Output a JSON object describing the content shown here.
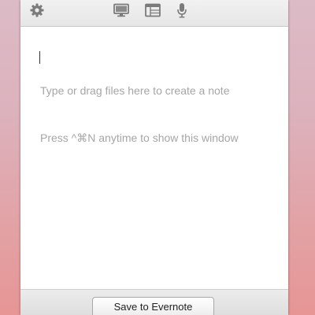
{
  "toolbar": {
    "icons": [
      {
        "name": "gear-icon",
        "color": "#7a7a7a"
      },
      {
        "name": "display-icon",
        "color": "#7a7a7a"
      },
      {
        "name": "window-capture-icon",
        "color": "#7a7a7a"
      },
      {
        "name": "microphone-icon",
        "color": "#7a7a7a"
      }
    ]
  },
  "note": {
    "placeholder_line1": "Type or drag files here to create a note",
    "placeholder_line2": "Press ^⌘N anytime to show this window"
  },
  "footer": {
    "save_label": "Save to Evernote"
  },
  "colors": {
    "background_top": "#dcbbc6",
    "background_bottom": "#e79595",
    "placeholder_text": "#a6a6a6"
  }
}
